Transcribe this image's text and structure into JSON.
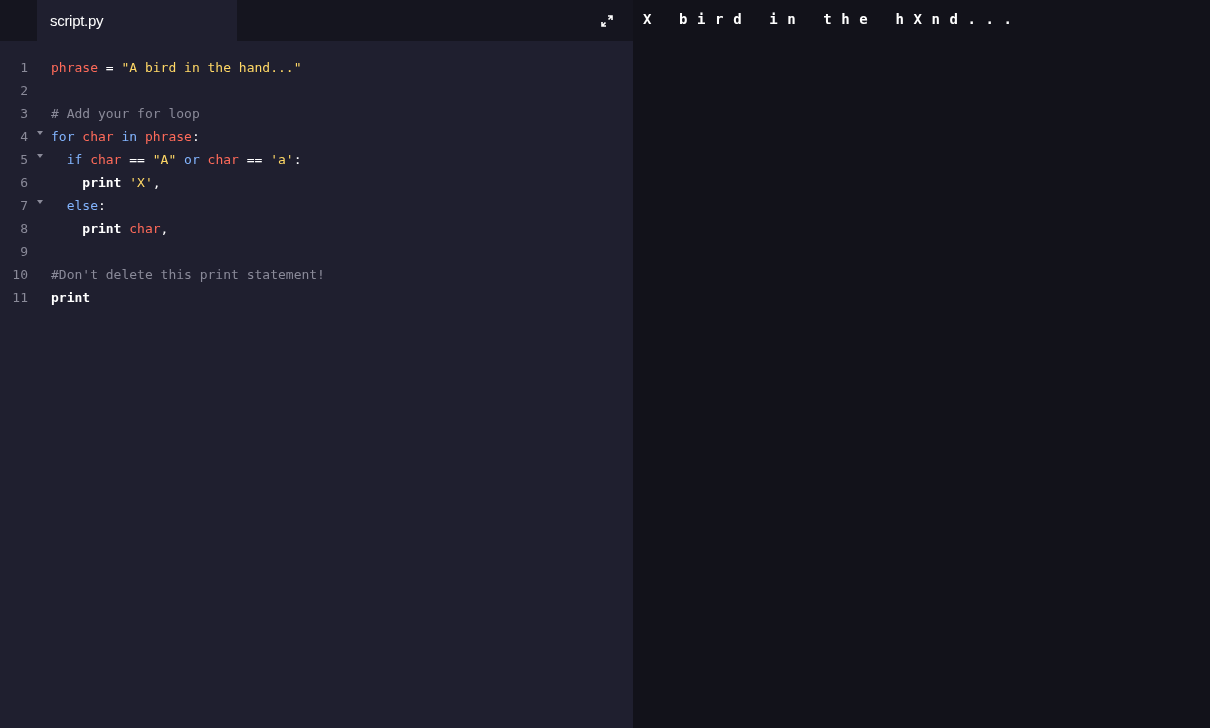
{
  "tabs": [
    {
      "label": "script.py",
      "selected": true
    }
  ],
  "code": [
    {
      "number": "1",
      "foldable": false,
      "tokens": [
        {
          "kind": "var",
          "text": "phrase"
        },
        {
          "kind": "op",
          "text": " = "
        },
        {
          "kind": "str",
          "text": "\"A bird in the hand...\""
        }
      ]
    },
    {
      "number": "2",
      "foldable": false
    },
    {
      "number": "3",
      "foldable": false,
      "tokens": [
        {
          "kind": "comment",
          "text": "# Add your for loop"
        }
      ]
    },
    {
      "number": "4",
      "foldable": true,
      "tokens": [
        {
          "kind": "kw",
          "text": "for "
        },
        {
          "kind": "var",
          "text": "char"
        },
        {
          "kind": "kw",
          "text": " in "
        },
        {
          "kind": "var",
          "text": "phrase"
        },
        {
          "kind": "op",
          "text": ":"
        }
      ]
    },
    {
      "number": "5",
      "foldable": true,
      "tokens": [
        {
          "kind": "kw",
          "text": "  if "
        },
        {
          "kind": "var",
          "text": "char"
        },
        {
          "kind": "op",
          "text": " == "
        },
        {
          "kind": "str",
          "text": "\"A\""
        },
        {
          "kind": "kw",
          "text": " or "
        },
        {
          "kind": "var",
          "text": "char"
        },
        {
          "kind": "op",
          "text": " == "
        },
        {
          "kind": "str",
          "text": "'a'"
        },
        {
          "kind": "op",
          "text": ":"
        }
      ]
    },
    {
      "number": "6",
      "foldable": false,
      "tokens": [
        {
          "kind": "builtin",
          "text": "    print "
        },
        {
          "kind": "str",
          "text": "'X'"
        },
        {
          "kind": "op",
          "text": ","
        }
      ]
    },
    {
      "number": "7",
      "foldable": true,
      "tokens": [
        {
          "kind": "kw",
          "text": "  else"
        },
        {
          "kind": "op",
          "text": ":"
        }
      ]
    },
    {
      "number": "8",
      "foldable": false,
      "tokens": [
        {
          "kind": "builtin",
          "text": "    print "
        },
        {
          "kind": "var",
          "text": "char"
        },
        {
          "kind": "op",
          "text": ","
        }
      ]
    },
    {
      "number": "9",
      "foldable": false
    },
    {
      "number": "10",
      "foldable": false,
      "tokens": [
        {
          "kind": "comment",
          "text": "#Don't delete this print statement!"
        }
      ]
    },
    {
      "number": "11",
      "foldable": false,
      "tokens": [
        {
          "kind": "builtin",
          "text": "print"
        }
      ]
    }
  ],
  "output": [
    "X bird in the hXnd..."
  ]
}
